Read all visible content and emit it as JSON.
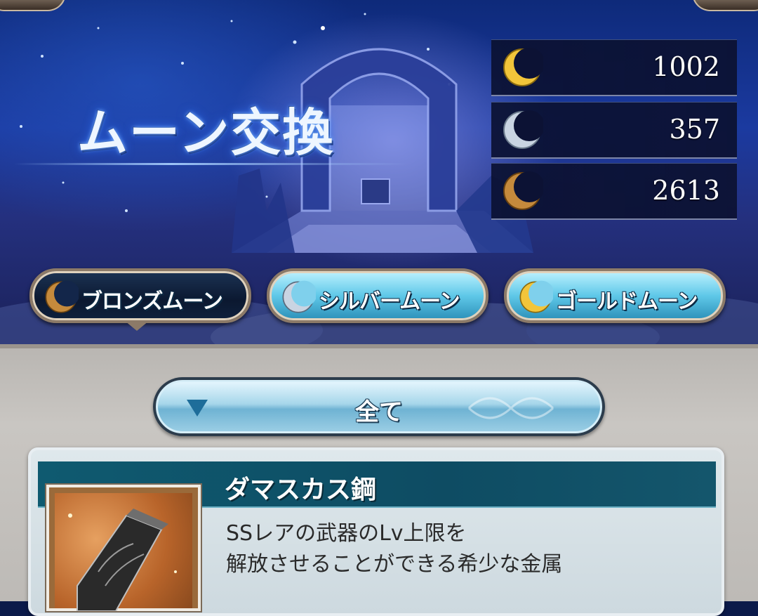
{
  "screen": {
    "title": "ムーン交換"
  },
  "currencies": [
    {
      "type": "gold",
      "amount": "1002",
      "color": "#f2c53a"
    },
    {
      "type": "silver",
      "amount": "357",
      "color": "#c9d4e2"
    },
    {
      "type": "bronze",
      "amount": "2613",
      "color": "#c58a3c"
    }
  ],
  "tabs": [
    {
      "label": "ブロンズムーン",
      "active": true,
      "moon": "bronze-moon-icon"
    },
    {
      "label": "シルバームーン",
      "active": false,
      "moon": "silver-moon-icon"
    },
    {
      "label": "ゴールドムーン",
      "active": false,
      "moon": "gold-moon-icon"
    }
  ],
  "filter": {
    "label": "全て",
    "icon": "dropdown-triangle-icon"
  },
  "item": {
    "name": "ダマスカス鋼",
    "description_line1": "SSレアの武器のLv上限を",
    "description_line2": "解放させることができる希少な金属"
  },
  "colors": {
    "accent_blue": "#5fc8e8",
    "header_teal": "#0f5a70",
    "frame_bronze": "#8c7a68"
  }
}
